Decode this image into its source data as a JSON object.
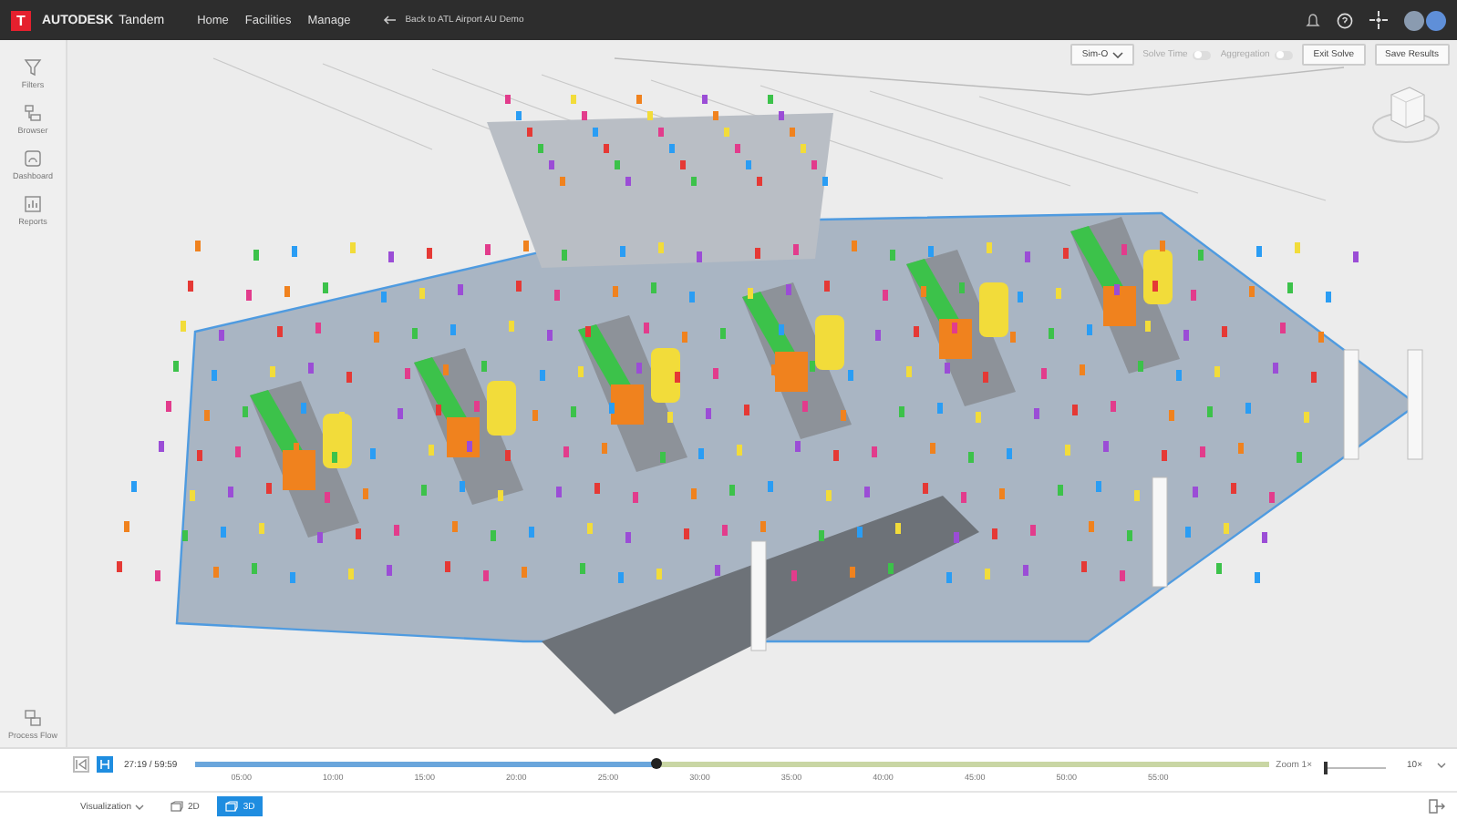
{
  "header": {
    "logo_letter": "T",
    "brand": "AUTODESK",
    "product": "Tandem",
    "nav": [
      {
        "label": "Home"
      },
      {
        "label": "Facilities"
      },
      {
        "label": "Manage"
      }
    ],
    "back_link": "Back to ATL Airport AU Demo"
  },
  "sidebar": {
    "items": [
      {
        "label": "Filters",
        "kind": "filter"
      },
      {
        "label": "Browser",
        "kind": "browser"
      },
      {
        "label": "Dashboard",
        "kind": "dashboard"
      },
      {
        "label": "Reports",
        "kind": "reports"
      }
    ],
    "footer_item": {
      "label": "Process Flow",
      "kind": "flow"
    }
  },
  "toolbar": {
    "scenario": "Sim-O",
    "toggles": [
      {
        "label": "Solve Time",
        "on": false
      },
      {
        "label": "Aggregation",
        "on": false
      }
    ],
    "buttons": [
      "Exit Solve",
      "Save Results"
    ]
  },
  "timeline": {
    "time": "27:19 / 59:59",
    "level": 0.43,
    "ticks": [
      "05:00",
      "10:00",
      "15:00",
      "20:00",
      "25:00",
      "30:00",
      "35:00",
      "40:00",
      "45:00",
      "50:00",
      "55:00"
    ],
    "zoom": {
      "label": "Zoom 1×",
      "level": 0.03
    },
    "speed": "10×"
  },
  "bottom_bar": {
    "visualization": "Visualization",
    "views": [
      {
        "label": "2D",
        "selected": false
      },
      {
        "label": "3D",
        "selected": true
      }
    ]
  }
}
